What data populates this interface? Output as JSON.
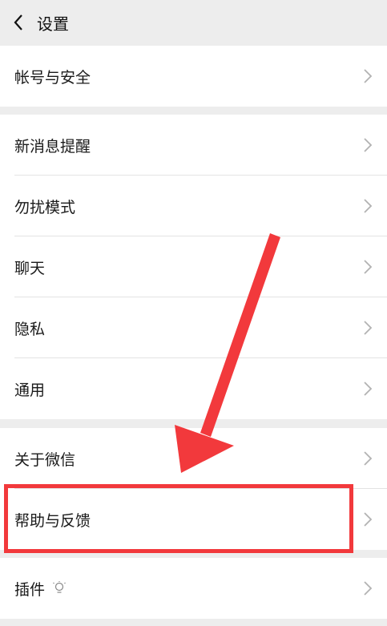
{
  "header": {
    "title": "设置",
    "back_icon": "chevron-left-icon"
  },
  "groups": [
    {
      "items": [
        {
          "label": "帐号与安全"
        }
      ]
    },
    {
      "items": [
        {
          "label": "新消息提醒"
        },
        {
          "label": "勿扰模式"
        },
        {
          "label": "聊天"
        },
        {
          "label": "隐私"
        },
        {
          "label": "通用"
        }
      ]
    },
    {
      "items": [
        {
          "label": "关于微信"
        },
        {
          "label": "帮助与反馈"
        },
        {
          "label": "插件",
          "icon": "lightbulb-icon"
        }
      ]
    }
  ],
  "annotation": {
    "highlight_color": "#f2393c",
    "target_item": "帮助与反馈"
  },
  "colors": {
    "background": "#ededed",
    "row": "#ffffff",
    "chevron": "#b2b2b2"
  }
}
